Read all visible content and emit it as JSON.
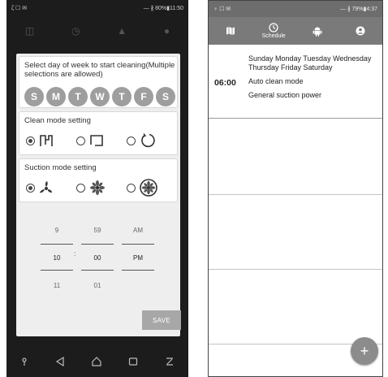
{
  "left": {
    "status": {
      "left_icons": "ζ ☐ ✉",
      "right_text": "— ∦ 80%▮11:50"
    },
    "toolbar_icons": [
      "map-icon",
      "schedule-icon",
      "robot-icon",
      "account-icon"
    ],
    "day_section": {
      "title": "Select day of week to start cleaning(Multiple selections are allowed)",
      "days": [
        "S",
        "M",
        "T",
        "W",
        "T",
        "F",
        "S"
      ]
    },
    "clean_section": {
      "title": "Clean mode setting",
      "options": [
        "auto-path-icon",
        "spot-square-icon",
        "circle-arrow-icon"
      ],
      "selected": 0
    },
    "suction_section": {
      "title": "Suction mode setting",
      "options": [
        "fan-low-icon",
        "fan-medium-icon",
        "fan-high-icon"
      ],
      "selected": 0
    },
    "picker": {
      "hour": [
        "9",
        "10",
        "11"
      ],
      "minute": [
        "59",
        "00",
        "01"
      ],
      "ampm": [
        "AM",
        "PM",
        ""
      ],
      "separator": ":"
    },
    "save_label": "SAVE",
    "nav_icons": [
      "mic-icon",
      "back-icon",
      "home-icon",
      "recents-icon",
      "menu-icon"
    ]
  },
  "right": {
    "status": {
      "left_icons": "♀ ☐ ✉",
      "right_text": "— ∦ 79%▮4:37"
    },
    "tabs": [
      {
        "icon": "map-icon",
        "label": ""
      },
      {
        "icon": "schedule-icon",
        "label": "Schedule"
      },
      {
        "icon": "robot-icon",
        "label": ""
      },
      {
        "icon": "account-icon",
        "label": ""
      }
    ],
    "schedule": {
      "time": "06:00",
      "days": "Sunday Monday Tuesday Wednesday Thursday Friday Saturday",
      "mode": "Auto clean mode",
      "power": "General suction power"
    },
    "fab_label": "+"
  }
}
